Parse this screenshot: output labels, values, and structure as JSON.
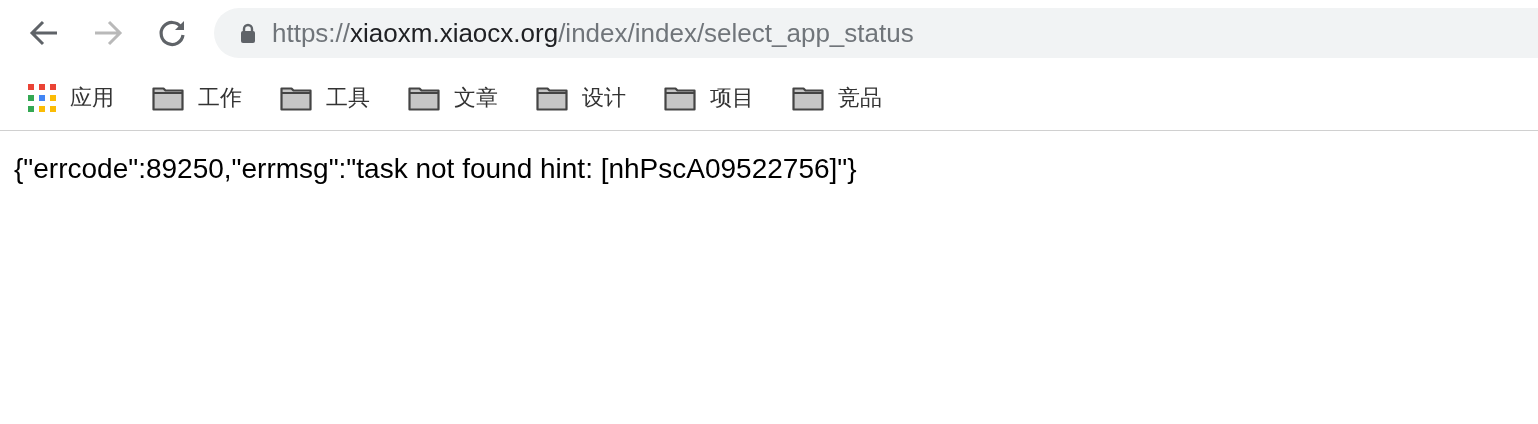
{
  "toolbar": {
    "back": {
      "disabled": false
    },
    "forward": {
      "disabled": true
    },
    "address": {
      "scheme": "https://",
      "host": "xiaoxm.xiaocx.org",
      "path": "/index/index/select_app_status"
    }
  },
  "bookmarks": [
    {
      "kind": "apps",
      "label": "应用"
    },
    {
      "kind": "folder",
      "label": "工作"
    },
    {
      "kind": "folder",
      "label": "工具"
    },
    {
      "kind": "folder",
      "label": "文章"
    },
    {
      "kind": "folder",
      "label": "设计"
    },
    {
      "kind": "folder",
      "label": "项目"
    },
    {
      "kind": "folder",
      "label": "竞品"
    }
  ],
  "page": {
    "body_text": "{\"errcode\":89250,\"errmsg\":\"task not found hint: [nhPscA09522756]\"}"
  }
}
